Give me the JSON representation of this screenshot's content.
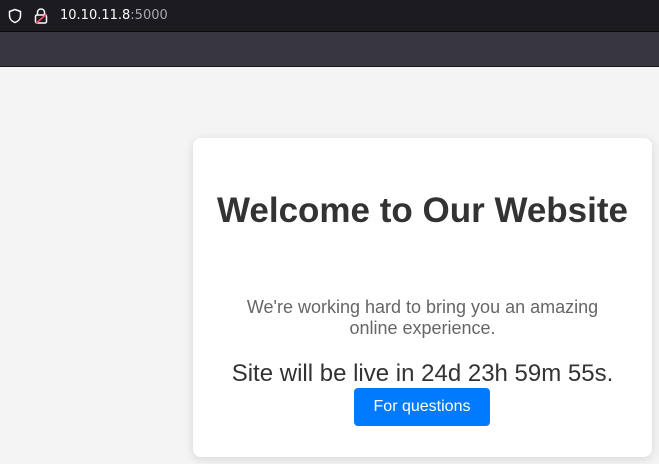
{
  "browser": {
    "url_host": "10.10.11.8",
    "url_port": ":5000",
    "icons": {
      "tracking_protection": "shield-icon",
      "connection": "insecure-lock-icon"
    }
  },
  "page": {
    "headline": "Welcome to Our Website",
    "subtext": "We're working hard to bring you an amazing online experience.",
    "countdown": "Site will be live in 24d 23h 59m 55s.",
    "button_label": "For questions"
  },
  "colors": {
    "button": "#007bff",
    "page_background": "#f4f4f4",
    "card_background": "#ffffff",
    "headline": "#333333",
    "subtext": "#666666"
  }
}
